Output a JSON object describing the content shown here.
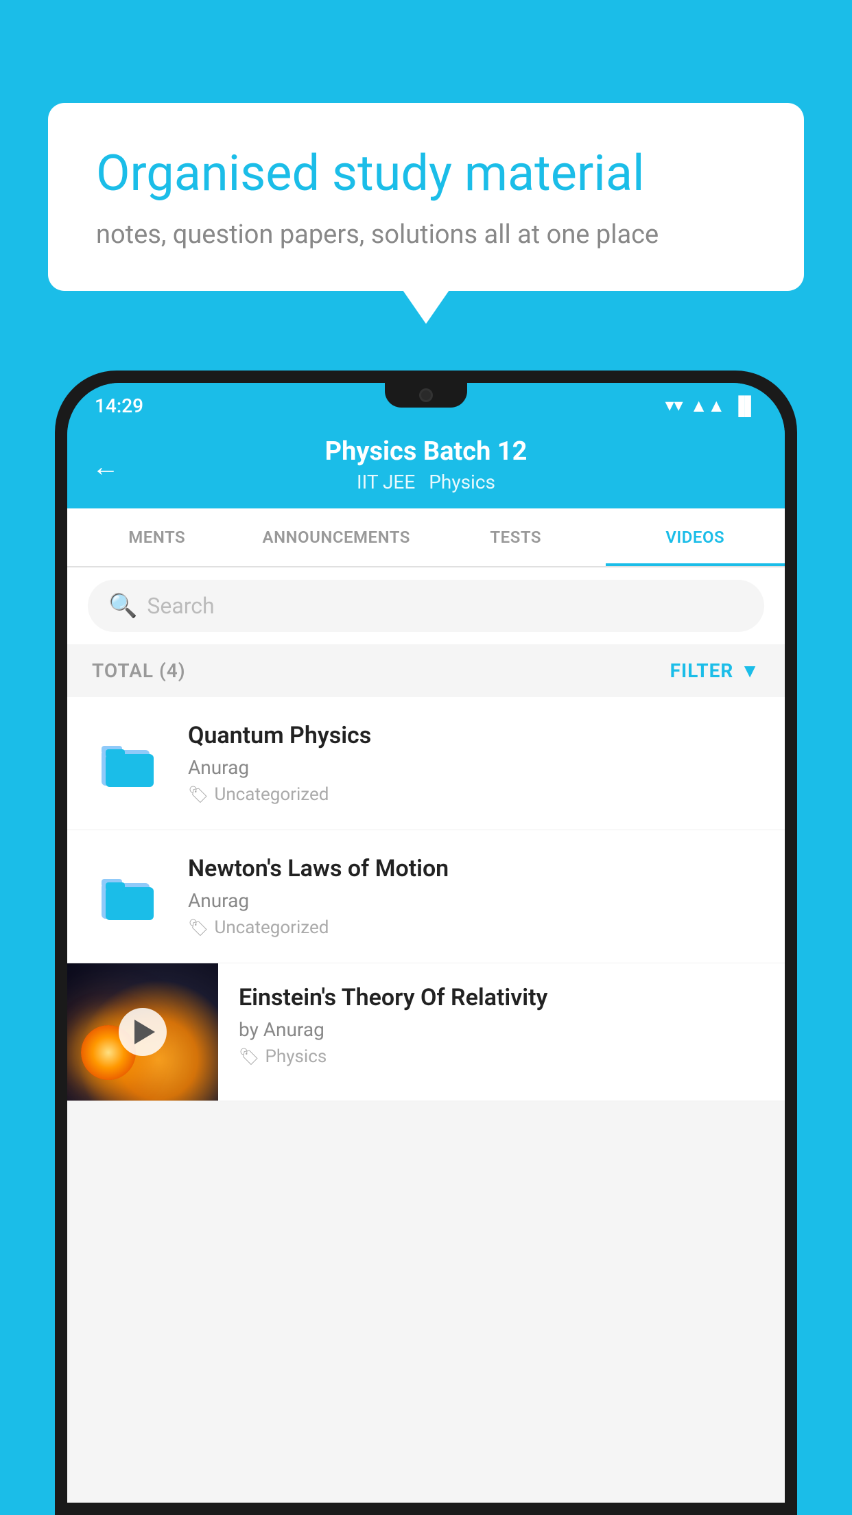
{
  "background": {
    "color": "#1bbde8"
  },
  "speech_bubble": {
    "title": "Organised study material",
    "subtitle": "notes, question papers, solutions all at one place"
  },
  "status_bar": {
    "time": "14:29",
    "wifi": "▼",
    "signal": "▲",
    "battery": "▐"
  },
  "header": {
    "back_label": "←",
    "title": "Physics Batch 12",
    "tag1": "IIT JEE",
    "tag2": "Physics"
  },
  "tabs": [
    {
      "label": "MENTS",
      "active": false
    },
    {
      "label": "ANNOUNCEMENTS",
      "active": false
    },
    {
      "label": "TESTS",
      "active": false
    },
    {
      "label": "VIDEOS",
      "active": true
    }
  ],
  "search": {
    "placeholder": "Search"
  },
  "filter_bar": {
    "total_label": "TOTAL (4)",
    "filter_label": "FILTER"
  },
  "videos": [
    {
      "id": "v1",
      "title": "Quantum Physics",
      "author": "Anurag",
      "tag": "Uncategorized",
      "type": "folder"
    },
    {
      "id": "v2",
      "title": "Newton's Laws of Motion",
      "author": "Anurag",
      "tag": "Uncategorized",
      "type": "folder"
    },
    {
      "id": "v3",
      "title": "Einstein's Theory Of Relativity",
      "author": "by Anurag",
      "tag": "Physics",
      "type": "video"
    }
  ]
}
